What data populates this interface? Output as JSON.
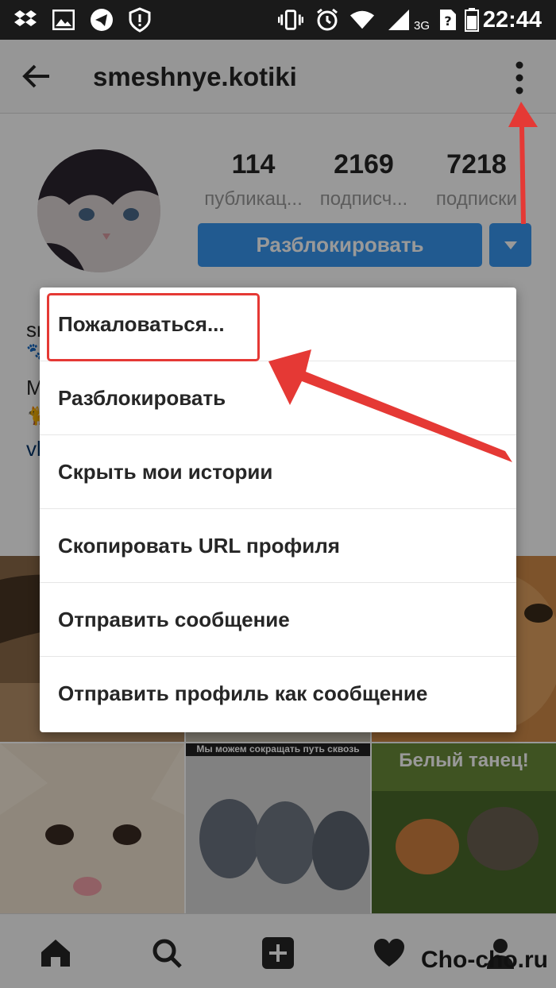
{
  "status_bar": {
    "time": "22:44",
    "network": "3G",
    "icons": [
      "dropbox-icon",
      "image-icon",
      "telegram-icon",
      "shield-icon",
      "vibrate-icon",
      "alarm-icon",
      "wifi-icon",
      "signal-icon",
      "battery-icon"
    ]
  },
  "app_bar": {
    "username": "smeshnye.kotiki"
  },
  "profile": {
    "stats": [
      {
        "value": "114",
        "label": "публикац..."
      },
      {
        "value": "2169",
        "label": "подписч..."
      },
      {
        "value": "7218",
        "label": "подписки"
      }
    ],
    "unblock_label": "Разблокировать",
    "bio_lines": [
      "sm",
      "🐾",
      "M",
      "🐈",
      "vk"
    ]
  },
  "grid": {
    "captions": [
      "Мы можем сокращать путь сквозь",
      "Белый танец!"
    ]
  },
  "menu": {
    "items": [
      "Пожаловаться...",
      "Разблокировать",
      "Скрыть мои истории",
      "Скопировать URL профиля",
      "Отправить сообщение",
      "Отправить профиль как сообщение"
    ]
  },
  "watermark": "Cho-cho.ru",
  "colors": {
    "accent": "#3897f0",
    "annotation": "#e53935"
  }
}
